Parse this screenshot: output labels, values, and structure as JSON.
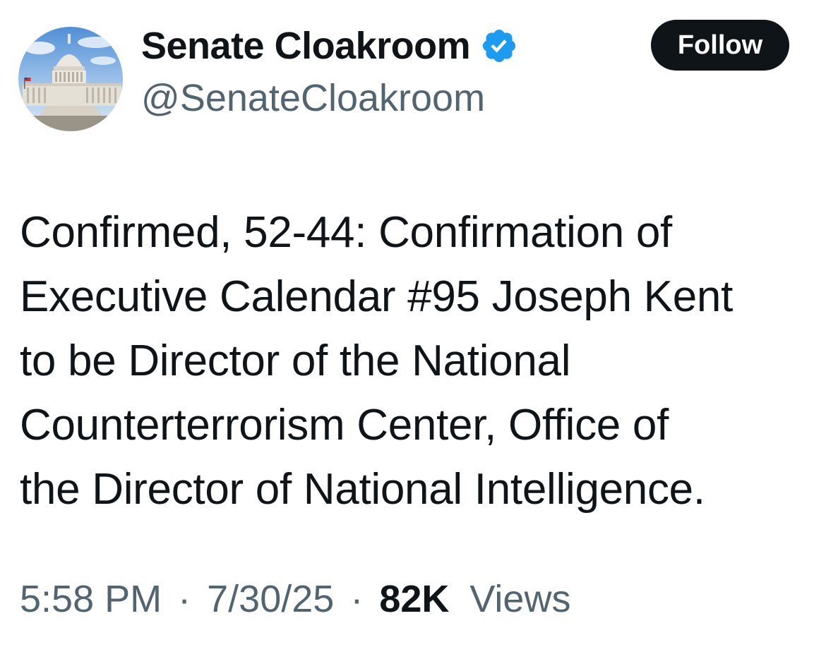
{
  "author": {
    "display_name": "Senate Cloakroom",
    "handle": "@SenateCloakroom",
    "avatar_icon": "capitol-building-avatar",
    "verified_icon": "verified-badge-icon",
    "verified_color": "#1d9bf0"
  },
  "follow_button": {
    "label": "Follow",
    "background": "#0f1419",
    "text_color": "#ffffff"
  },
  "tweet": {
    "lines": [
      "Confirmed, 52-44: Confirmation of",
      "Executive Calendar #95 Joseph Kent",
      "to be Director of the National",
      "Counterterrorism Center, Office of",
      "the Director of National Intelligence."
    ]
  },
  "meta": {
    "time": "5:58 PM",
    "separator": "·",
    "date": "7/30/25",
    "views_count": "82K",
    "views_label": "Views"
  },
  "colors": {
    "text_primary": "#0f1419",
    "text_secondary": "#536471"
  }
}
